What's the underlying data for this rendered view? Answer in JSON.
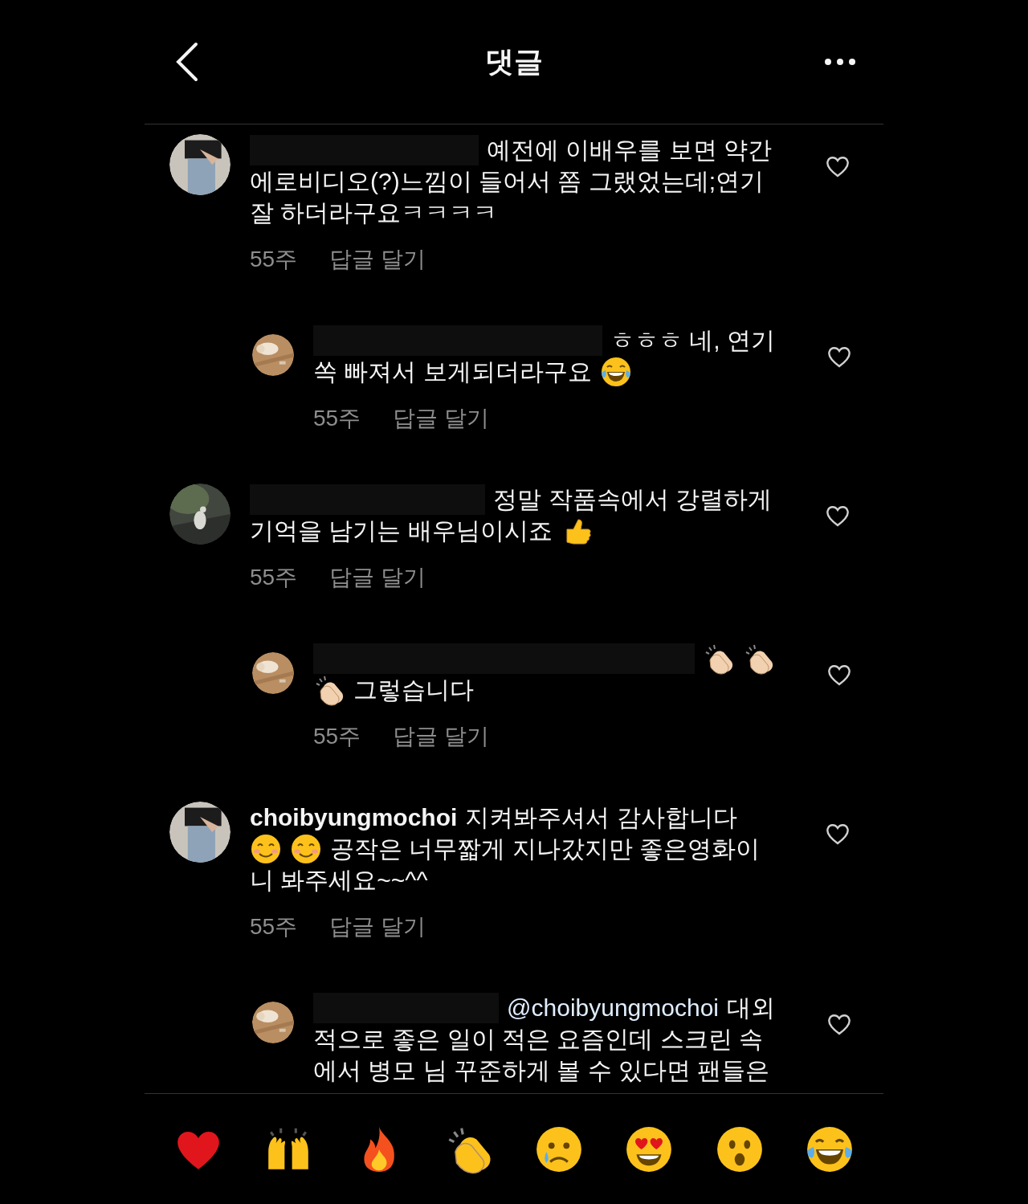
{
  "header": {
    "title": "댓글"
  },
  "comments": [
    {
      "kind": "comment",
      "liked": false,
      "lines": [
        [
          {
            "kind": "redacted"
          },
          {
            "kind": "text",
            "text": "예전에 이배우를 보면 약간"
          }
        ],
        [
          {
            "kind": "text",
            "text": "에로비디오(?)느낌이 들어서 쫌 그랬었는데;연기"
          }
        ],
        [
          {
            "kind": "text",
            "text": "잘 하더라구요ㅋㅋㅋㅋ"
          }
        ]
      ],
      "time": "55주",
      "reply": "답글 달기"
    },
    {
      "kind": "reply",
      "liked": false,
      "lines": [
        [
          {
            "kind": "redacted"
          },
          {
            "kind": "text",
            "text": "ㅎㅎㅎ 네, 연기"
          }
        ],
        [
          {
            "kind": "text",
            "text": "쏙 빠져서 보게되더라구요"
          },
          {
            "kind": "emoji_laugh"
          }
        ]
      ],
      "time": "55주",
      "reply": "답글 달기"
    },
    {
      "kind": "comment",
      "liked": false,
      "lines": [
        [
          {
            "kind": "redacted"
          },
          {
            "kind": "text",
            "text": "정말  작품속에서  강렬하게"
          }
        ],
        [
          {
            "kind": "text",
            "text": "기억을 남기는 배우님이시죠"
          },
          {
            "kind": "emoji_thumb"
          }
        ]
      ],
      "time": "55주",
      "reply": "답글 달기"
    },
    {
      "kind": "reply",
      "liked": false,
      "lines": [
        [
          {
            "kind": "redacted"
          },
          {
            "kind": "emoji_clap"
          },
          {
            "kind": "emoji_clap"
          }
        ],
        [
          {
            "kind": "emoji_clap"
          },
          {
            "kind": "text",
            "text": "그렇습니다"
          }
        ]
      ],
      "time": "55주",
      "reply": "답글 달기"
    },
    {
      "kind": "comment",
      "liked": false,
      "lines": [
        [
          {
            "kind": "username",
            "text": "choibyungmochoi"
          },
          {
            "kind": "text",
            "text": "지켜봐주셔서 감사합니다"
          }
        ],
        [
          {
            "kind": "emoji_smile"
          },
          {
            "kind": "emoji_smile"
          },
          {
            "kind": "text",
            "text": "공작은 너무짧게 지나갔지만 좋은영화이"
          }
        ],
        [
          {
            "kind": "text",
            "text": "니 봐주세요~~^^"
          }
        ]
      ],
      "time": "55주",
      "reply": "답글 달기"
    },
    {
      "kind": "reply",
      "liked": false,
      "lines": [
        [
          {
            "kind": "redacted"
          },
          {
            "kind": "mention",
            "text": "@choibyungmochoi"
          },
          {
            "kind": "text",
            "text": "대외"
          }
        ],
        [
          {
            "kind": "text",
            "text": "적으로 좋은 일이 적은 요즘인데 스크린 속"
          }
        ],
        [
          {
            "kind": "text",
            "text": "에서 병모 님 꾸준하게 볼 수 있다면 팬들은"
          }
        ]
      ]
    }
  ],
  "reactions": [
    {
      "kind": "heart"
    },
    {
      "kind": "raised_hands"
    },
    {
      "kind": "fire"
    },
    {
      "kind": "clap"
    },
    {
      "kind": "cry"
    },
    {
      "kind": "heart_eyes"
    },
    {
      "kind": "surprised"
    },
    {
      "kind": "laugh"
    }
  ]
}
